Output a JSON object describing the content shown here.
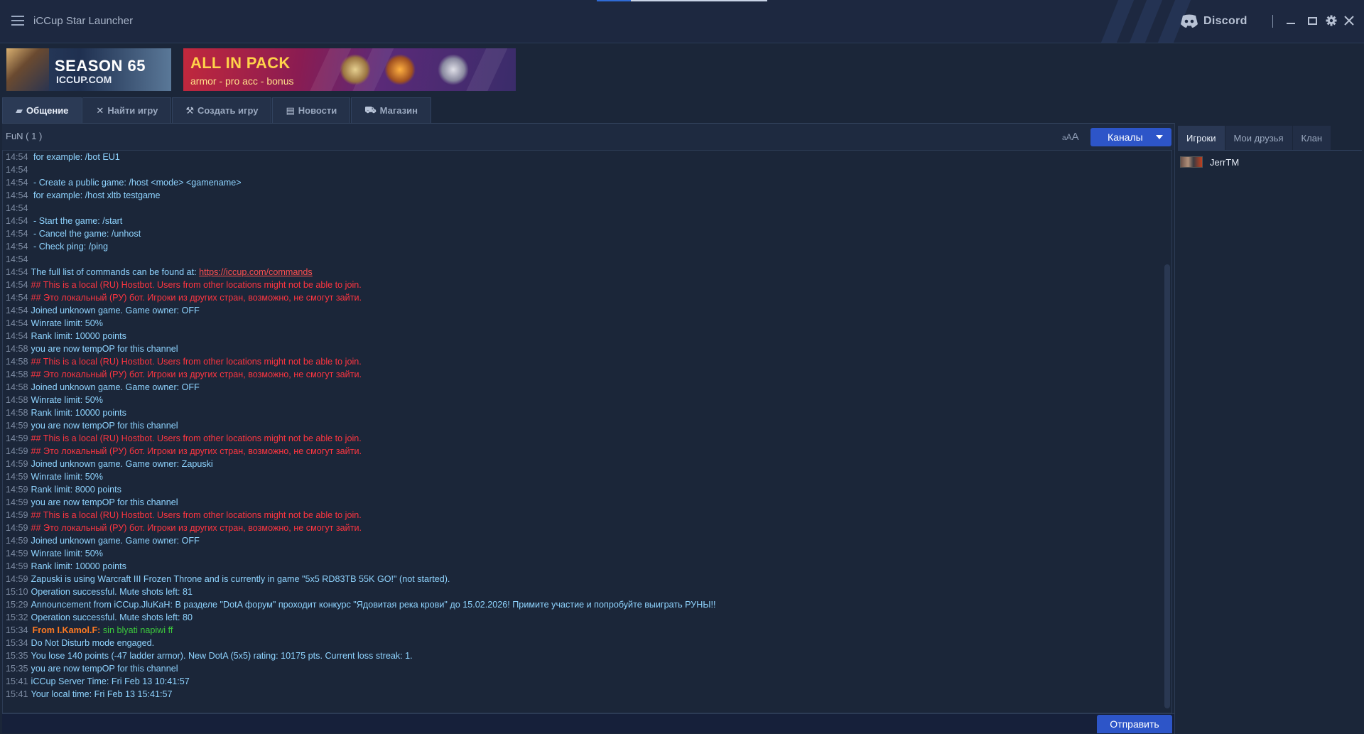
{
  "app": {
    "title": "iCCup Star Launcher"
  },
  "titlebar": {
    "discord_label": "Discord"
  },
  "banners": {
    "season": {
      "line1": "SEASON 65",
      "line2": "ICCUP.COM"
    },
    "pack": {
      "line1": "ALL IN PACK",
      "line2": "armor - pro acc - bonus"
    }
  },
  "tabs": [
    {
      "label": "Общение",
      "icon": "chat-icon",
      "active": true
    },
    {
      "label": "Найти игру",
      "icon": "swords-icon",
      "active": false
    },
    {
      "label": "Создать игру",
      "icon": "hammer-icon",
      "active": false
    },
    {
      "label": "Новости",
      "icon": "newspaper-icon",
      "active": false
    },
    {
      "label": "Магазин",
      "icon": "cart-icon",
      "active": false
    }
  ],
  "chat": {
    "channel": "FuN  ( 1 )",
    "font_toggle": {
      "small": "a",
      "mid": "A",
      "large": "A"
    },
    "channels_button": "Каналы",
    "send_button": "Отправить",
    "colors": {
      "system": "#8fd4ff",
      "warning": "#ff3540",
      "from": "#ff7a22",
      "whisper": "#3cc83c"
    },
    "lines": [
      {
        "time": "14:54",
        "text": " for example: /bot EU1",
        "kind": "blue"
      },
      {
        "time": "14:54",
        "text": "",
        "kind": "blue"
      },
      {
        "time": "14:54",
        "text": " - Create a public game: /host <mode> <gamename>",
        "kind": "blue"
      },
      {
        "time": "14:54",
        "text": " for example: /host xltb testgame",
        "kind": "blue"
      },
      {
        "time": "14:54",
        "text": "",
        "kind": "blue"
      },
      {
        "time": "14:54",
        "text": " - Start the game: /start",
        "kind": "blue"
      },
      {
        "time": "14:54",
        "text": " - Cancel the game: /unhost",
        "kind": "blue"
      },
      {
        "time": "14:54",
        "text": " - Check ping: /ping",
        "kind": "blue"
      },
      {
        "time": "14:54",
        "text": "",
        "kind": "blue"
      },
      {
        "time": "14:54",
        "text": "The full list of commands can be found at: ",
        "link": "https://iccup.com/commands",
        "kind": "blue"
      },
      {
        "time": "14:54",
        "text": "## This is a local (RU) Hostbot. Users from other locations might not be able to join.",
        "kind": "red"
      },
      {
        "time": "14:54",
        "text": "## Это локальный (РУ) бот. Игроки из других стран, возможно, не смогут зайти.",
        "kind": "red"
      },
      {
        "time": "14:54",
        "text": "Joined unknown game. Game owner: OFF",
        "kind": "blue"
      },
      {
        "time": "14:54",
        "text": "Winrate limit: 50%",
        "kind": "blue"
      },
      {
        "time": "14:54",
        "text": "Rank limit: 10000 points",
        "kind": "blue"
      },
      {
        "time": "14:58",
        "text": "you are now tempOP for this channel",
        "kind": "blue"
      },
      {
        "time": "14:58",
        "text": "## This is a local (RU) Hostbot. Users from other locations might not be able to join.",
        "kind": "red"
      },
      {
        "time": "14:58",
        "text": "## Это локальный (РУ) бот. Игроки из других стран, возможно, не смогут зайти.",
        "kind": "red"
      },
      {
        "time": "14:58",
        "text": "Joined unknown game. Game owner: OFF",
        "kind": "blue"
      },
      {
        "time": "14:58",
        "text": "Winrate limit: 50%",
        "kind": "blue"
      },
      {
        "time": "14:58",
        "text": "Rank limit: 10000 points",
        "kind": "blue"
      },
      {
        "time": "14:59",
        "text": "you are now tempOP for this channel",
        "kind": "blue"
      },
      {
        "time": "14:59",
        "text": "## This is a local (RU) Hostbot. Users from other locations might not be able to join.",
        "kind": "red"
      },
      {
        "time": "14:59",
        "text": "## Это локальный (РУ) бот. Игроки из других стран, возможно, не смогут зайти.",
        "kind": "red"
      },
      {
        "time": "14:59",
        "text": "Joined unknown game. Game owner: Zapuski",
        "kind": "blue"
      },
      {
        "time": "14:59",
        "text": "Winrate limit: 50%",
        "kind": "blue"
      },
      {
        "time": "14:59",
        "text": "Rank limit: 8000 points",
        "kind": "blue"
      },
      {
        "time": "14:59",
        "text": "you are now tempOP for this channel",
        "kind": "blue"
      },
      {
        "time": "14:59",
        "text": "## This is a local (RU) Hostbot. Users from other locations might not be able to join.",
        "kind": "red"
      },
      {
        "time": "14:59",
        "text": "## Это локальный (РУ) бот. Игроки из других стран, возможно, не смогут зайти.",
        "kind": "red"
      },
      {
        "time": "14:59",
        "text": "Joined unknown game. Game owner: OFF",
        "kind": "blue"
      },
      {
        "time": "14:59",
        "text": "Winrate limit: 50%",
        "kind": "blue"
      },
      {
        "time": "14:59",
        "text": "Rank limit: 10000 points",
        "kind": "blue"
      },
      {
        "time": "14:59",
        "text": "Zapuski is using Warcraft III Frozen Throne and is currently in  game \"5x5 RD83TB 55K GO!\" (not started).",
        "kind": "blue"
      },
      {
        "time": "15:10",
        "text": "Operation successful. Mute shots left: 81",
        "kind": "blue"
      },
      {
        "time": "15:29",
        "text": "Announcement from iCCup.JluKaH: В разделе \"DotA форум\"  проходит конкурс \"Ядовитая река крови\" до 15.02.2026! Примите участие и  попробуйте выиграть РУНЫ!!",
        "kind": "blue"
      },
      {
        "time": "15:32",
        "text": "Operation successful. Mute shots left: 80",
        "kind": "blue"
      },
      {
        "time": "15:34",
        "from": "From I.Kamol.F:",
        "text": " sin blyati napiwi ff",
        "kind": "whisper"
      },
      {
        "time": "15:34",
        "text": "Do Not Disturb mode engaged.",
        "kind": "blue"
      },
      {
        "time": "15:35",
        "text": "You lose 140 points (-47 ladder armor). New DotA (5x5) rating: 10175 pts. Current loss streak: 1.",
        "kind": "blue"
      },
      {
        "time": "15:35",
        "text": "you are now tempOP for this channel",
        "kind": "blue"
      },
      {
        "time": "15:41",
        "text": "iCCup Server Time: Fri Feb 13 10:41:57",
        "kind": "blue"
      },
      {
        "time": "15:41",
        "text": "Your local time: Fri Feb 13 15:41:57",
        "kind": "blue"
      }
    ],
    "input": {
      "value": "",
      "placeholder": ""
    }
  },
  "right_panel": {
    "tabs": [
      {
        "label": "Игроки",
        "active": true
      },
      {
        "label": "Мои друзья",
        "active": false
      },
      {
        "label": "Клан",
        "active": false
      }
    ],
    "players": [
      {
        "name": "JerrTM"
      }
    ]
  }
}
